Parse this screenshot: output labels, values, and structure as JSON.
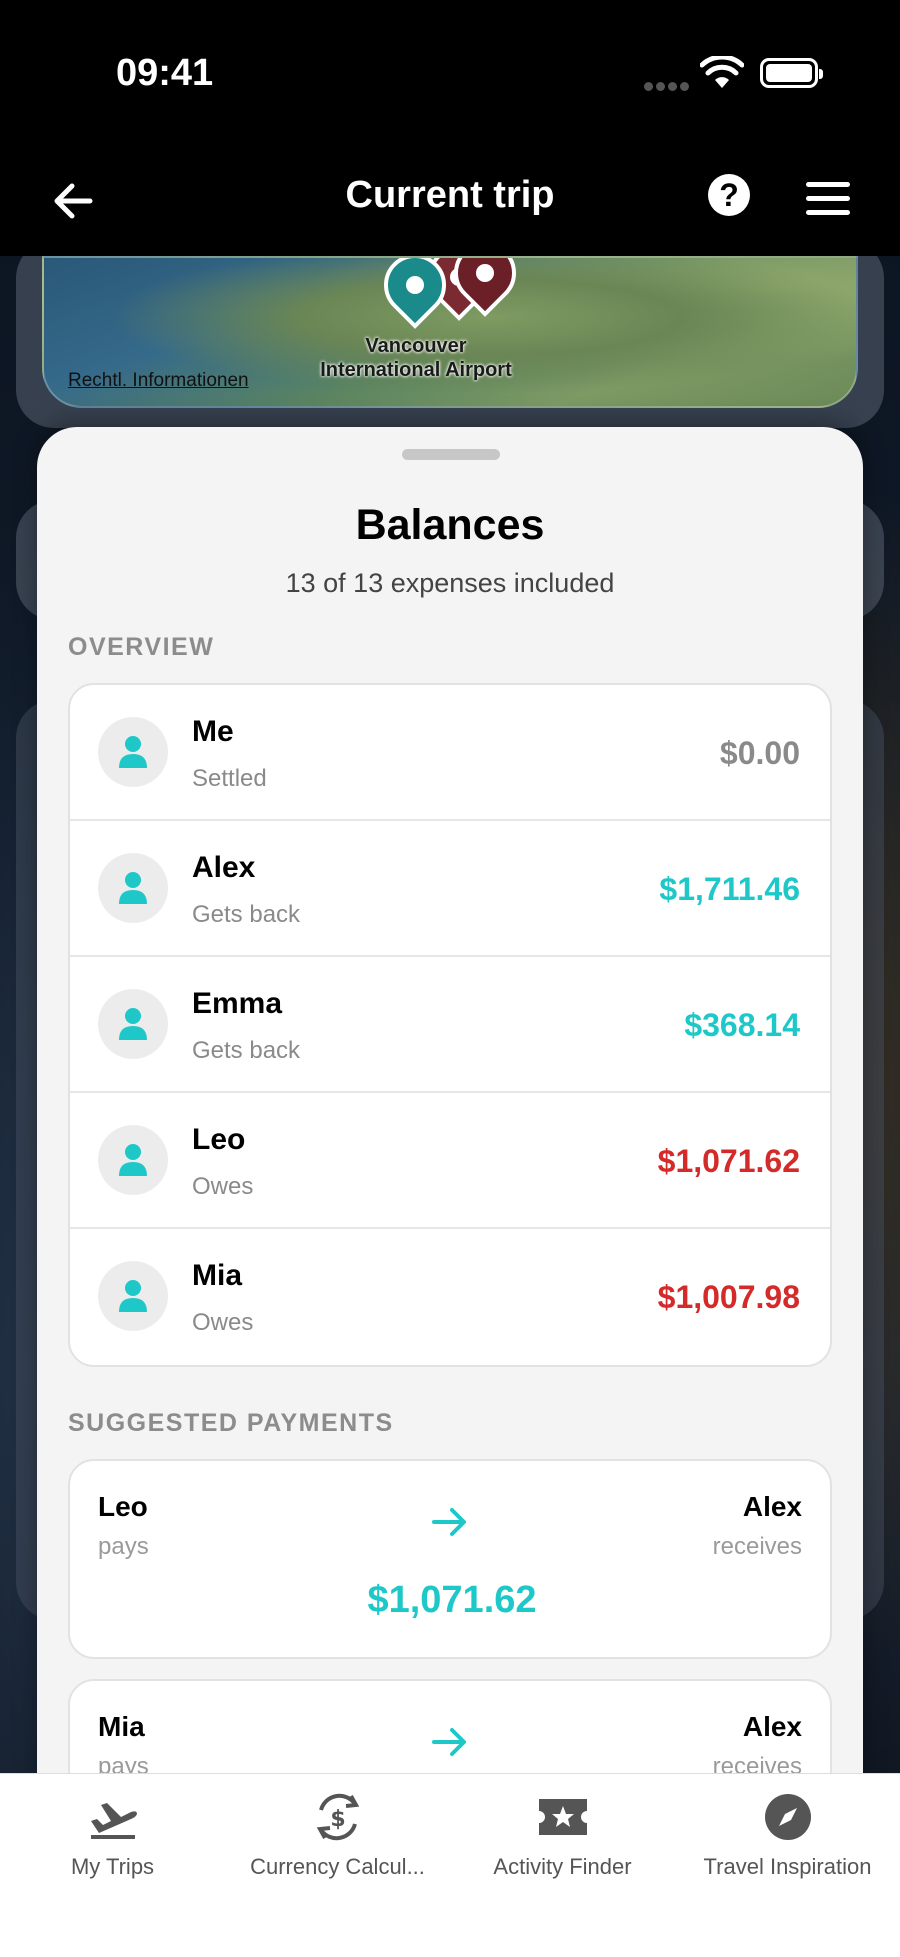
{
  "status_bar": {
    "time": "09:41"
  },
  "nav": {
    "title": "Current trip"
  },
  "map": {
    "legal_link": "Rechtl. Informationen",
    "airport_label_line1": "Vancouver",
    "airport_label_line2": "International Airport"
  },
  "balances": {
    "title": "Balances",
    "subtitle": "13 of 13 expenses included",
    "overview_header": "OVERVIEW",
    "people": [
      {
        "name": "Me",
        "status": "Settled",
        "amount": "$0.00",
        "tone": "neutral"
      },
      {
        "name": "Alex",
        "status": "Gets back",
        "amount": "$1,711.46",
        "tone": "positive"
      },
      {
        "name": "Emma",
        "status": "Gets back",
        "amount": "$368.14",
        "tone": "positive"
      },
      {
        "name": "Leo",
        "status": "Owes",
        "amount": "$1,071.62",
        "tone": "negative"
      },
      {
        "name": "Mia",
        "status": "Owes",
        "amount": "$1,007.98",
        "tone": "negative"
      }
    ],
    "suggested_header": "SUGGESTED PAYMENTS",
    "payments": [
      {
        "from": "Leo",
        "from_action": "pays",
        "to": "Alex",
        "to_action": "receives",
        "amount": "$1,071.62"
      },
      {
        "from": "Mia",
        "from_action": "pays",
        "to": "Alex",
        "to_action": "receives",
        "amount": ""
      }
    ]
  },
  "tab_bar": {
    "tabs": [
      {
        "label": "My Trips",
        "icon": "plane-departure-icon"
      },
      {
        "label": "Currency Calcul...",
        "icon": "currency-exchange-icon"
      },
      {
        "label": "Activity Finder",
        "icon": "ticket-star-icon"
      },
      {
        "label": "Travel Inspiration",
        "icon": "compass-icon"
      }
    ]
  },
  "colors": {
    "accent": "#1ec8c8",
    "negative": "#d42a2a",
    "neutral": "#8a8a8a"
  }
}
